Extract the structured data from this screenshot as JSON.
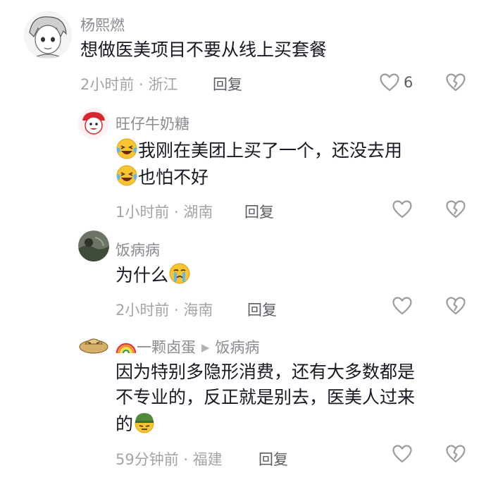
{
  "comments": [
    {
      "username": "杨熙燃",
      "text": "想做医美项目不要从线上买套餐",
      "time_location": "2小时前 · 浙江",
      "reply_label": "回复",
      "like_count": "6"
    },
    {
      "username": "旺仔牛奶糖",
      "line1": "我刚在美团上买了一个，还没去用",
      "line2": "也怕不好",
      "time_location": "1小时前 · 湖南",
      "reply_label": "回复"
    },
    {
      "username": "饭病病",
      "text": "为什么",
      "time_location": "2小时前 · 海南",
      "reply_label": "回复"
    },
    {
      "username": "一颗卤蛋",
      "reply_to": "饭病病",
      "line1": "因为特别多隐形消费，还有大多数都是",
      "line2": "不专业的，反正就是别去，医美人过来",
      "line3": "的",
      "time_location": "59分钟前 · 福建",
      "reply_label": "回复"
    }
  ],
  "icons": {
    "like": "heart-outline-icon",
    "dislike": "broken-heart-icon",
    "emoji_laugh_cry": "laughing-crying-emoji",
    "emoji_crying": "crying-emoji",
    "emoji_soldier": "soldier-helmet-emoji",
    "rainbow": "rainbow-emoji",
    "reply_arrow": "reply-arrow-icon"
  },
  "colors": {
    "text_primary": "#161823",
    "username": "#8a8b91",
    "meta": "#a3a4a8",
    "icon": "#9b9ca0"
  }
}
